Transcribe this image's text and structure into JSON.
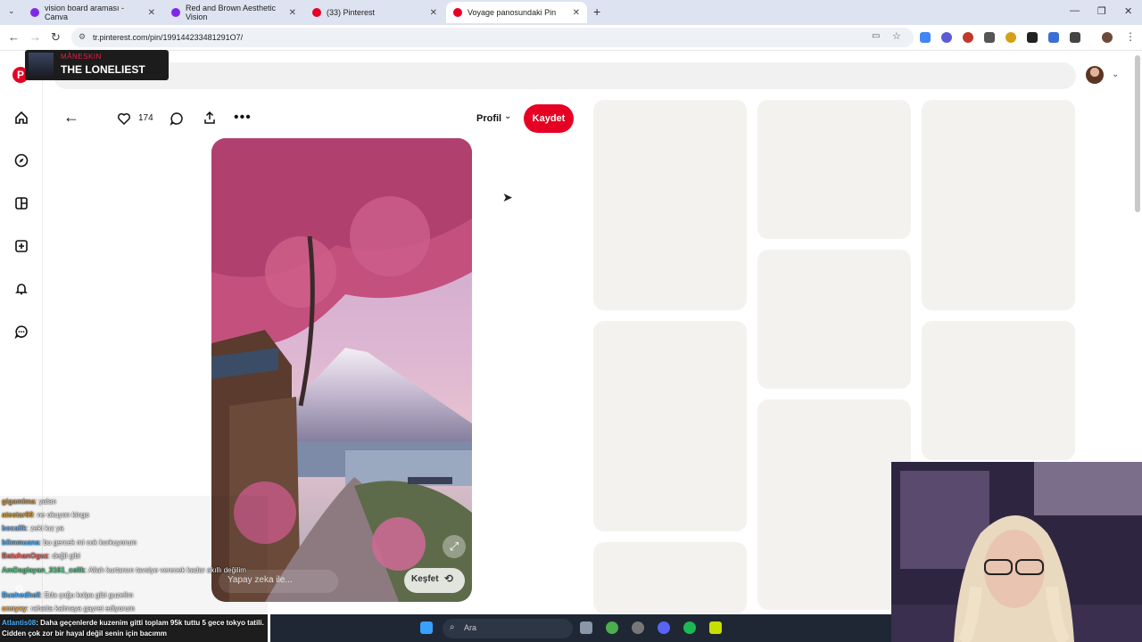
{
  "browser": {
    "tabs": [
      {
        "title": "vision board araması - Canva",
        "color": "#7d2ae8"
      },
      {
        "title": "Red and Brown Aesthetic Vision",
        "color": "#7d2ae8"
      },
      {
        "title": "(33) Pinterest",
        "color": "#e60023"
      },
      {
        "title": "Voyage panosundaki Pin",
        "color": "#e60023"
      }
    ],
    "url": "tr.pinterest.com/pin/199144233481291O7/"
  },
  "pinterest": {
    "like_count": "174",
    "profile_label": "Profil",
    "save_label": "Kaydet",
    "ai_label": "Yapay zeka ile...",
    "explore_label": "Keşfet"
  },
  "nowplaying": {
    "artist": "MÅNESKIN",
    "title": "THE LONELIEST"
  },
  "chat": [
    {
      "user": "gigamima",
      "msg": ": yalan",
      "color": "#d39b4b"
    },
    {
      "user": "atestar69",
      "msg": ": ne okuyon kingo",
      "color": "#d8a03a"
    },
    {
      "user": "bocalik",
      "msg": ": zeki kız ya",
      "color": "#6fb0ff"
    },
    {
      "user": "bilmmuana",
      "msg": ": bu gercek mi cok korkuyorum",
      "color": "#4fb3ff"
    },
    {
      "user": "BatuhanOguz",
      "msg": ": değil gibi",
      "color": "#ff5d5d"
    },
    {
      "user": "AmDaglayan_3161_celik",
      "msg": ": Allah kurtarsın tavsiye verecek kadar akıllı değilim",
      "color": "#40d080"
    },
    {
      "user": "Bushedhell",
      "msg": ": Eda çoğu kolpa gibi guzelim",
      "color": "#4fb3ff"
    },
    {
      "user": "onnyxy",
      "msg": ": rahatta kalmaya gayret ediyorum",
      "color": "#ffb347"
    },
    {
      "user": "Atlantis08",
      "msg": ": Daha geçenlerde kuzenim gitti toplam 95k tuttu 5 gece tokyo tatili. Cidden çok zor bir hayal değil senin için bacımm",
      "color": "#4fb3ff"
    }
  ],
  "taskbar": {
    "search_placeholder": "Ara"
  }
}
